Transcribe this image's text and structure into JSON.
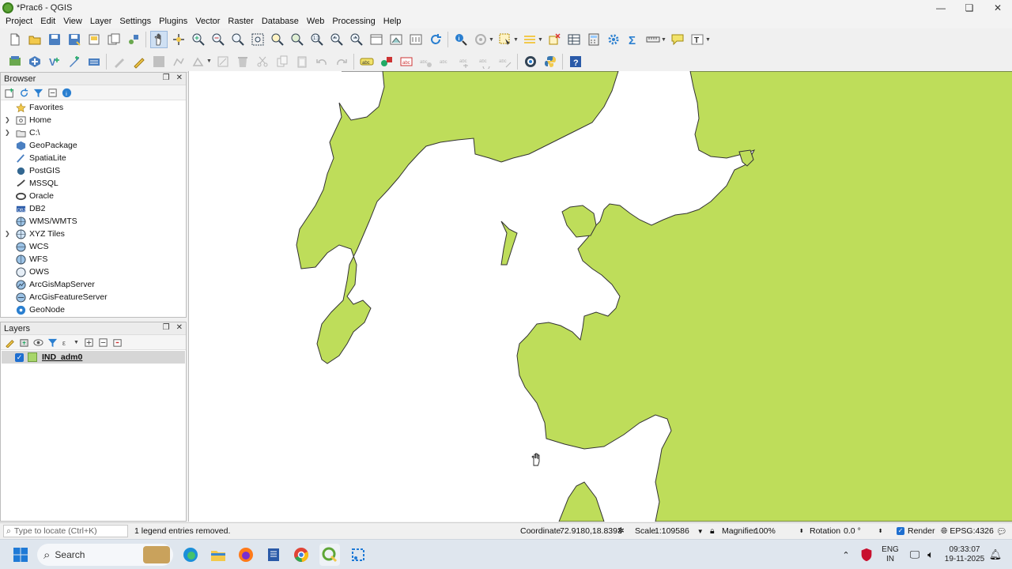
{
  "window": {
    "title": "*Prac6 - QGIS",
    "controls": {
      "minimize": "—",
      "maximize": "❏",
      "close": "✕"
    }
  },
  "menu": [
    "Project",
    "Edit",
    "View",
    "Layer",
    "Settings",
    "Plugins",
    "Vector",
    "Raster",
    "Database",
    "Web",
    "Processing",
    "Help"
  ],
  "browser": {
    "title": "Browser",
    "items": [
      {
        "label": "Favorites",
        "icon": "star-icon",
        "expandable": false
      },
      {
        "label": "Home",
        "icon": "home-folder-icon",
        "expandable": true
      },
      {
        "label": "C:\\",
        "icon": "drive-icon",
        "expandable": true
      },
      {
        "label": "GeoPackage",
        "icon": "geopackage-icon",
        "expandable": false
      },
      {
        "label": "SpatiaLite",
        "icon": "spatialite-icon",
        "expandable": false
      },
      {
        "label": "PostGIS",
        "icon": "postgis-icon",
        "expandable": false
      },
      {
        "label": "MSSQL",
        "icon": "mssql-icon",
        "expandable": false
      },
      {
        "label": "Oracle",
        "icon": "oracle-icon",
        "expandable": false
      },
      {
        "label": "DB2",
        "icon": "db2-icon",
        "expandable": false
      },
      {
        "label": "WMS/WMTS",
        "icon": "wms-icon",
        "expandable": false
      },
      {
        "label": "XYZ Tiles",
        "icon": "xyz-tiles-icon",
        "expandable": true
      },
      {
        "label": "WCS",
        "icon": "wcs-icon",
        "expandable": false
      },
      {
        "label": "WFS",
        "icon": "wfs-icon",
        "expandable": false
      },
      {
        "label": "OWS",
        "icon": "ows-icon",
        "expandable": false
      },
      {
        "label": "ArcGisMapServer",
        "icon": "arcgis-map-icon",
        "expandable": false
      },
      {
        "label": "ArcGisFeatureServer",
        "icon": "arcgis-feature-icon",
        "expandable": false
      },
      {
        "label": "GeoNode",
        "icon": "geonode-icon",
        "expandable": false
      }
    ]
  },
  "layers": {
    "title": "Layers",
    "items": [
      {
        "name": "IND_adm0",
        "checked": true,
        "fill_color": "#a8d66a"
      }
    ]
  },
  "map": {
    "land_color": "#bedd5a",
    "water_color": "#ffffff",
    "outline_color": "#333333"
  },
  "status": {
    "locate_placeholder": "Type to locate (Ctrl+K)",
    "message": "1 legend entries removed.",
    "coordinate_label": "Coordinate",
    "coordinate_value": "72.9180,18.8393",
    "scale_label": "Scale",
    "scale_value": "1:109586",
    "magnifier_label": "Magnifier",
    "magnifier_value": "100%",
    "rotation_label": "Rotation",
    "rotation_value": "0.0 °",
    "render_label": "Render",
    "crs": "EPSG:4326"
  },
  "taskbar": {
    "search_label": "Search",
    "lang_top": "ENG",
    "lang_bottom": "IN",
    "time": "09:33:07",
    "date": "19-11-2025"
  }
}
